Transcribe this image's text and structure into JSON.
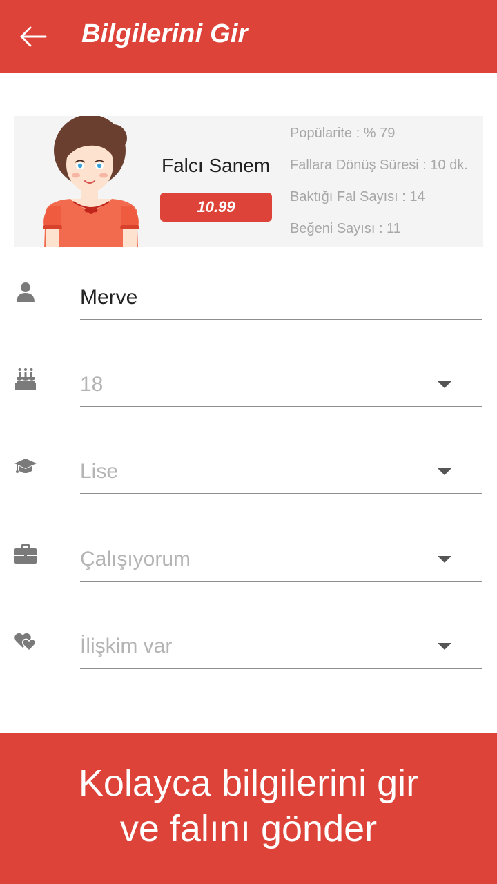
{
  "header": {
    "title": "Bilgilerini Gir",
    "back_icon": "arrow-left-icon"
  },
  "fortune_teller": {
    "name": "Falcı Sanem",
    "price": "10.99",
    "stats": [
      "Popülarite : % 79",
      "Fallara Dönüş Süresi : 10 dk.",
      "Baktığı Fal Sayısı : 14",
      "Beğeni Sayısı : 11"
    ]
  },
  "form": {
    "name": {
      "value": "Merve",
      "icon": "person-icon"
    },
    "age": {
      "value": "18",
      "icon": "birthday-cake-icon"
    },
    "education": {
      "value": "Lise",
      "icon": "graduation-cap-icon"
    },
    "employment": {
      "value": "Çalışıyorum",
      "icon": "briefcase-icon"
    },
    "relationship": {
      "value": "İlişkim var",
      "icon": "hearts-icon"
    }
  },
  "banner": {
    "line1": "Kolayca bilgilerini gir",
    "line2": "ve falını gönder"
  },
  "colors": {
    "primary": "#dd4339",
    "card_bg": "#f4f4f4",
    "muted_text": "#a7a7a7"
  }
}
